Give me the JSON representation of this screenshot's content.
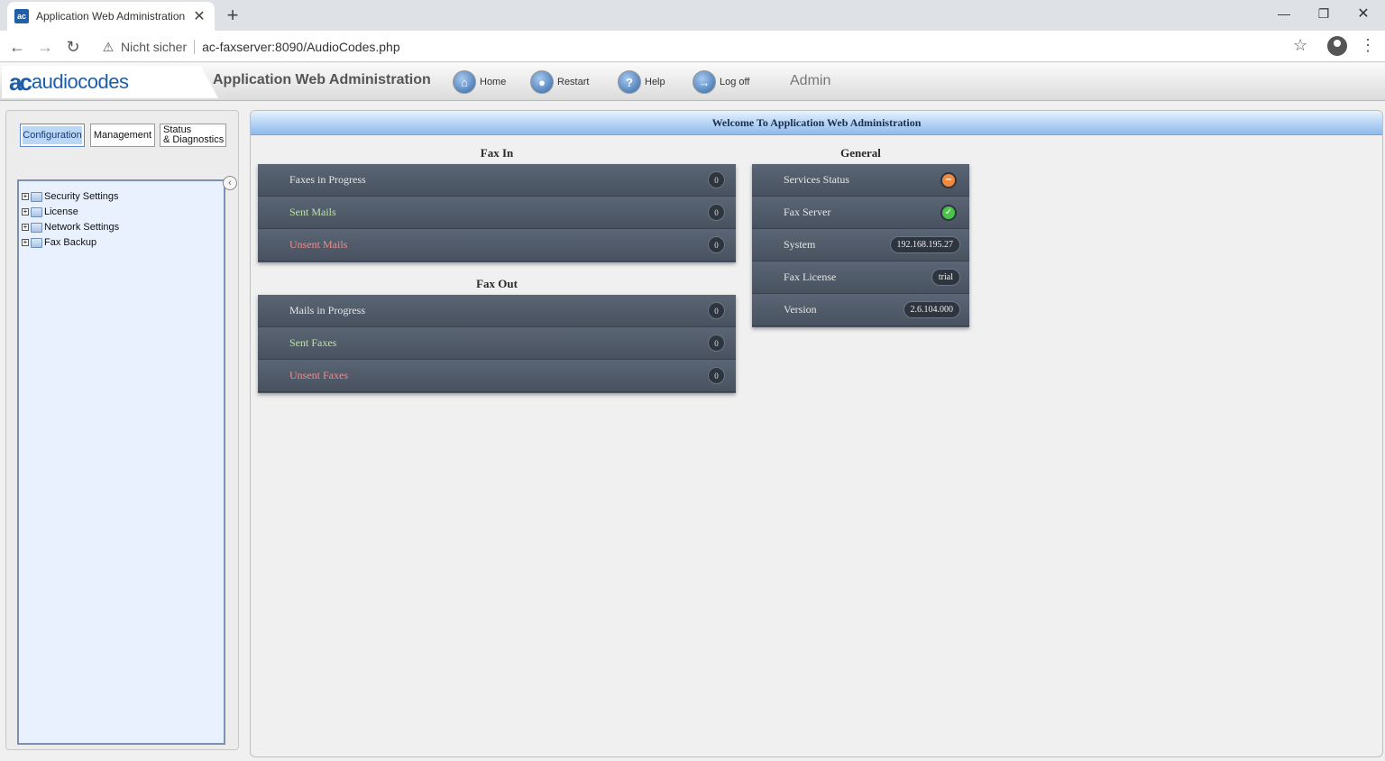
{
  "browser": {
    "tab_title": "Application Web Administration",
    "tab_favicon": "ac",
    "tab_close": "✕",
    "new_tab": "+",
    "not_secure": "Nicht sicher",
    "url": "ac-faxserver:8090/AudioCodes.php"
  },
  "header": {
    "logo_mark": "ac",
    "logo_text": "audiocodes",
    "app_title": "Application Web Administration",
    "buttons": {
      "home": "Home",
      "restart": "Restart",
      "help": "Help",
      "logoff": "Log off"
    },
    "user": "Admin"
  },
  "sidebar": {
    "tabs": {
      "configuration": "Configuration",
      "management": "Management",
      "status_line1": "Status",
      "status_line2": "& Diagnostics"
    },
    "tree": [
      "Security Settings",
      "License",
      "Network Settings",
      "Fax Backup"
    ]
  },
  "main": {
    "welcome": "Welcome To Application Web Administration",
    "fax_in": {
      "title": "Fax In",
      "rows": [
        {
          "label": "Faxes in Progress",
          "count": "0"
        },
        {
          "label": "Sent Mails",
          "count": "0"
        },
        {
          "label": "Unsent Mails",
          "count": "0"
        }
      ]
    },
    "fax_out": {
      "title": "Fax Out",
      "rows": [
        {
          "label": "Mails in Progress",
          "count": "0"
        },
        {
          "label": "Sent Faxes",
          "count": "0"
        },
        {
          "label": "Unsent Faxes",
          "count": "0"
        }
      ]
    },
    "general": {
      "title": "General",
      "rows": [
        {
          "label": "Services Status",
          "status": "warning",
          "color": "#f08a3c"
        },
        {
          "label": "Fax Server",
          "status": "ok",
          "color": "#4cc24a"
        },
        {
          "label": "System",
          "value": "192.168.195.27"
        },
        {
          "label": "Fax License",
          "value": "trial"
        },
        {
          "label": "Version",
          "value": "2.6.104.000"
        }
      ]
    }
  }
}
